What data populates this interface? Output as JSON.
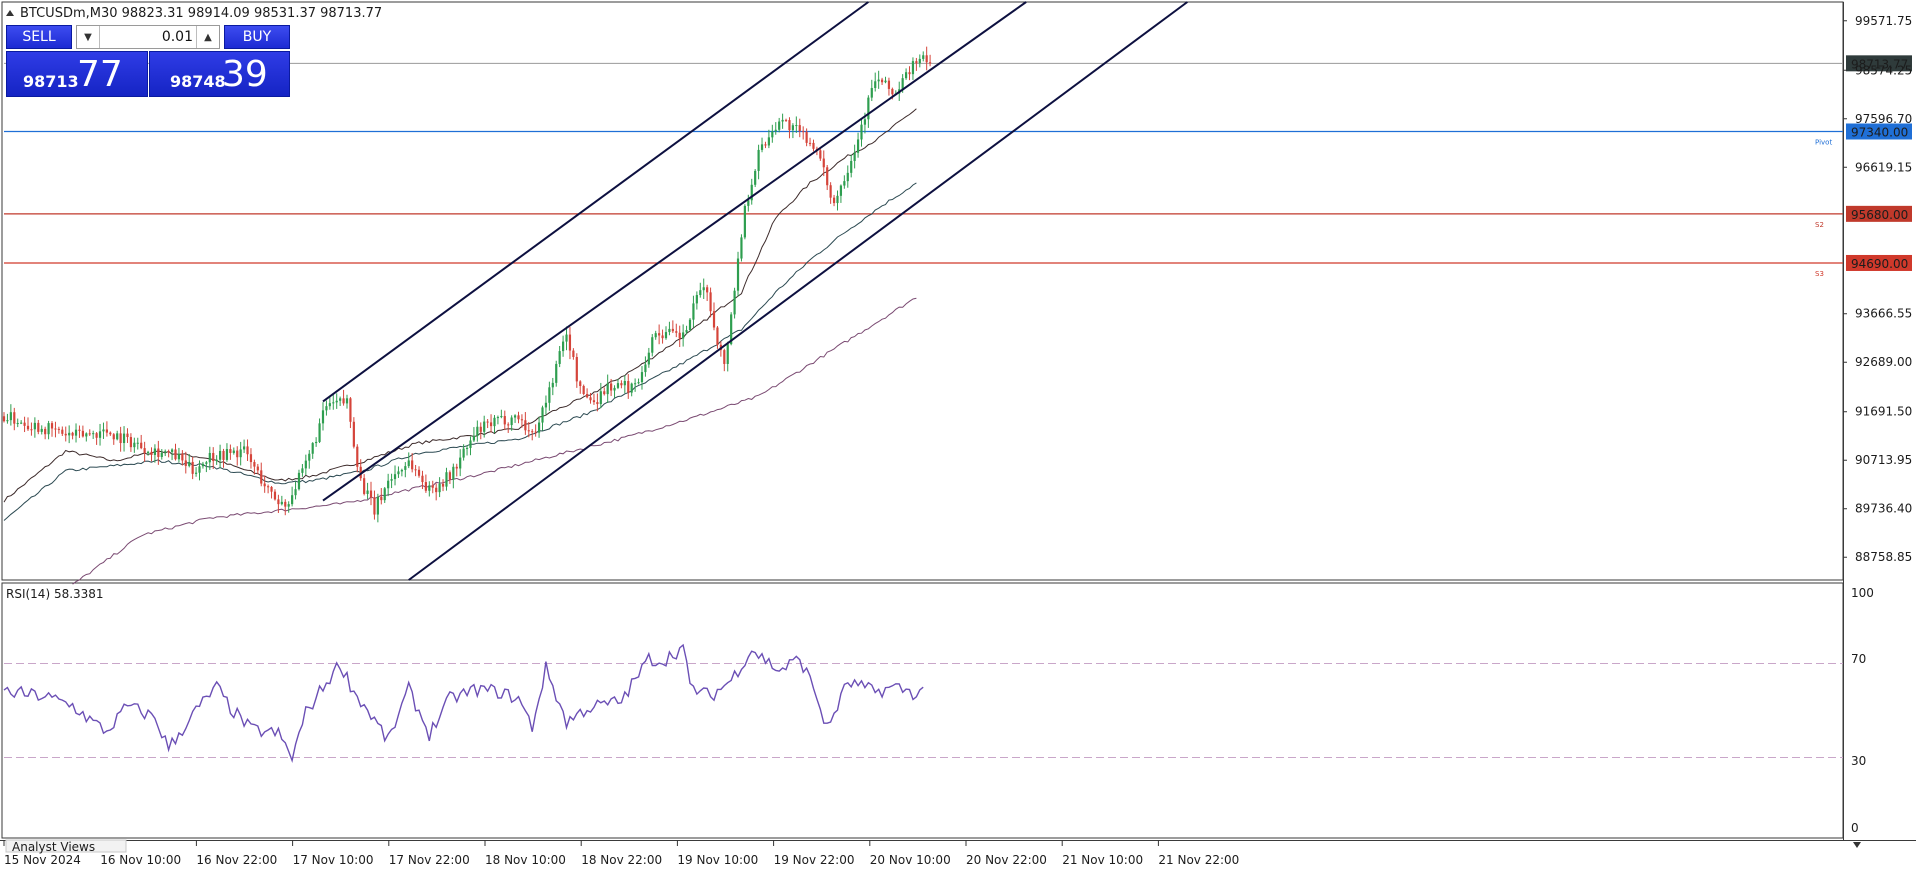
{
  "header": {
    "symbol_info": "BTCUSDm,M30  98823.31 98914.09 98531.37 98713.77"
  },
  "trade_panel": {
    "sell_label": "SELL",
    "buy_label": "BUY",
    "lot": "0.01",
    "bid_main": "98713",
    "bid_big": "77",
    "ask_main": "98748",
    "ask_big": "39",
    "button_color": "#2430d8"
  },
  "rsi": {
    "label": "RSI(14) 58.3381",
    "levels": [
      "100",
      "70",
      "30",
      "0"
    ]
  },
  "bottom_tab": "Analyst Views",
  "chart_data": {
    "type": "line",
    "title": "BTCUSDm,M30",
    "x_tick_labels": [
      "15 Nov 2024",
      "16 Nov 10:00",
      "16 Nov 22:00",
      "17 Nov 10:00",
      "17 Nov 22:00",
      "18 Nov 10:00",
      "18 Nov 22:00",
      "19 Nov 10:00",
      "19 Nov 22:00",
      "20 Nov 10:00",
      "20 Nov 22:00",
      "21 Nov 10:00",
      "21 Nov 22:00"
    ],
    "y_tick_labels": [
      "99571.75",
      "98574.25",
      "97596.70",
      "96619.15",
      "93666.55",
      "92689.00",
      "91691.50",
      "90713.95",
      "89736.40",
      "88758.85"
    ],
    "ylim": [
      88300,
      99950
    ],
    "current_price": 98713.77,
    "current_price_label": "98713.77",
    "horizontal_levels": [
      {
        "name": "Pivot",
        "value": 97340.0,
        "label": "97340.00",
        "color": "#1f6fd6"
      },
      {
        "name": "S2",
        "value": 95680.0,
        "label": "95680.00",
        "color": "#c0392b"
      },
      {
        "name": "S3",
        "value": 94690.0,
        "label": "94690.00",
        "color": "#d0392b"
      }
    ],
    "price_series": {
      "name": "BTCUSDm close",
      "anchors": [
        [
          0,
          91600
        ],
        [
          10,
          91400
        ],
        [
          20,
          91200
        ],
        [
          30,
          91300
        ],
        [
          40,
          91000
        ],
        [
          50,
          90800
        ],
        [
          55,
          90500
        ],
        [
          60,
          90800
        ],
        [
          70,
          90900
        ],
        [
          78,
          90000
        ],
        [
          82,
          89800
        ],
        [
          88,
          90600
        ],
        [
          94,
          91800
        ],
        [
          100,
          91900
        ],
        [
          104,
          90300
        ],
        [
          108,
          89700
        ],
        [
          112,
          90300
        ],
        [
          118,
          90700
        ],
        [
          124,
          90100
        ],
        [
          130,
          90400
        ],
        [
          138,
          91300
        ],
        [
          144,
          91500
        ],
        [
          150,
          91600
        ],
        [
          154,
          91200
        ],
        [
          158,
          91900
        ],
        [
          164,
          93300
        ],
        [
          168,
          92100
        ],
        [
          172,
          91900
        ],
        [
          176,
          92200
        ],
        [
          184,
          92200
        ],
        [
          190,
          93300
        ],
        [
          198,
          93200
        ],
        [
          204,
          94300
        ],
        [
          210,
          92600
        ],
        [
          216,
          95800
        ],
        [
          220,
          96900
        ],
        [
          226,
          97600
        ],
        [
          232,
          97300
        ],
        [
          236,
          97100
        ],
        [
          242,
          95900
        ],
        [
          248,
          97000
        ],
        [
          254,
          98400
        ],
        [
          260,
          98100
        ],
        [
          266,
          98800
        ],
        [
          270,
          98713.77
        ]
      ],
      "n_bars": 271,
      "start_bar": 0
    },
    "moving_averages": [
      {
        "name": "MA fast",
        "color": "#3d2b2b",
        "values": [
          [
            0,
            89900
          ],
          [
            18,
            90900
          ],
          [
            32,
            90700
          ],
          [
            45,
            90900
          ],
          [
            60,
            90750
          ],
          [
            80,
            90300
          ],
          [
            90,
            90400
          ],
          [
            105,
            90700
          ],
          [
            120,
            91050
          ],
          [
            135,
            91200
          ],
          [
            150,
            91350
          ],
          [
            160,
            91700
          ],
          [
            170,
            92000
          ],
          [
            185,
            92600
          ],
          [
            200,
            93300
          ],
          [
            215,
            94100
          ],
          [
            225,
            95600
          ],
          [
            235,
            96300
          ],
          [
            245,
            96800
          ],
          [
            255,
            97200
          ],
          [
            266,
            97800
          ]
        ]
      },
      {
        "name": "MA medium",
        "color": "#2c4a52",
        "values": [
          [
            0,
            89500
          ],
          [
            18,
            90500
          ],
          [
            32,
            90600
          ],
          [
            45,
            90700
          ],
          [
            60,
            90600
          ],
          [
            80,
            90250
          ],
          [
            90,
            90300
          ],
          [
            105,
            90500
          ],
          [
            120,
            90850
          ],
          [
            135,
            91000
          ],
          [
            150,
            91150
          ],
          [
            160,
            91400
          ],
          [
            170,
            91650
          ],
          [
            185,
            92200
          ],
          [
            200,
            92750
          ],
          [
            215,
            93350
          ],
          [
            225,
            94100
          ],
          [
            235,
            94750
          ],
          [
            245,
            95300
          ],
          [
            255,
            95800
          ],
          [
            266,
            96300
          ]
        ]
      },
      {
        "name": "MA slow",
        "color": "#7a4a72",
        "values": [
          [
            20,
            88200
          ],
          [
            40,
            89200
          ],
          [
            60,
            89550
          ],
          [
            80,
            89700
          ],
          [
            100,
            89850
          ],
          [
            120,
            90150
          ],
          [
            140,
            90450
          ],
          [
            160,
            90800
          ],
          [
            180,
            91150
          ],
          [
            200,
            91550
          ],
          [
            220,
            92000
          ],
          [
            235,
            92650
          ],
          [
            250,
            93300
          ],
          [
            266,
            94000
          ]
        ]
      }
    ],
    "trend_channel": [
      {
        "name": "Channel upper",
        "from": [
          93,
          91900
        ],
        "to": [
          252,
          99950
        ]
      },
      {
        "name": "Channel middle",
        "from": [
          93,
          89900
        ],
        "to": [
          298,
          99950
        ]
      },
      {
        "name": "Channel lower",
        "from": [
          118,
          88300
        ],
        "to": [
          345,
          99950
        ]
      }
    ],
    "rsi_series": {
      "name": "RSI(14)",
      "color": "#6b4fb5",
      "ylim": [
        0,
        100
      ],
      "overbought": 70,
      "oversold": 30,
      "last_value": 58.3381,
      "anchors": [
        [
          0,
          58
        ],
        [
          12,
          56
        ],
        [
          20,
          52
        ],
        [
          26,
          45
        ],
        [
          30,
          41
        ],
        [
          36,
          52
        ],
        [
          44,
          47
        ],
        [
          48,
          34
        ],
        [
          56,
          50
        ],
        [
          62,
          60
        ],
        [
          66,
          51
        ],
        [
          72,
          42
        ],
        [
          80,
          40
        ],
        [
          84,
          30
        ],
        [
          88,
          49
        ],
        [
          94,
          62
        ],
        [
          98,
          70
        ],
        [
          102,
          58
        ],
        [
          108,
          46
        ],
        [
          112,
          37
        ],
        [
          118,
          59
        ],
        [
          124,
          40
        ],
        [
          130,
          55
        ],
        [
          138,
          59
        ],
        [
          144,
          58
        ],
        [
          150,
          55
        ],
        [
          154,
          43
        ],
        [
          158,
          68
        ],
        [
          164,
          45
        ],
        [
          170,
          51
        ],
        [
          180,
          54
        ],
        [
          188,
          72
        ],
        [
          192,
          71
        ],
        [
          198,
          77
        ],
        [
          200,
          60
        ],
        [
          206,
          56
        ],
        [
          212,
          63
        ],
        [
          218,
          76
        ],
        [
          226,
          67
        ],
        [
          232,
          72
        ],
        [
          236,
          60
        ],
        [
          240,
          42
        ],
        [
          246,
          62
        ],
        [
          254,
          58
        ],
        [
          260,
          60
        ],
        [
          266,
          57
        ],
        [
          268,
          58.3
        ]
      ]
    }
  }
}
